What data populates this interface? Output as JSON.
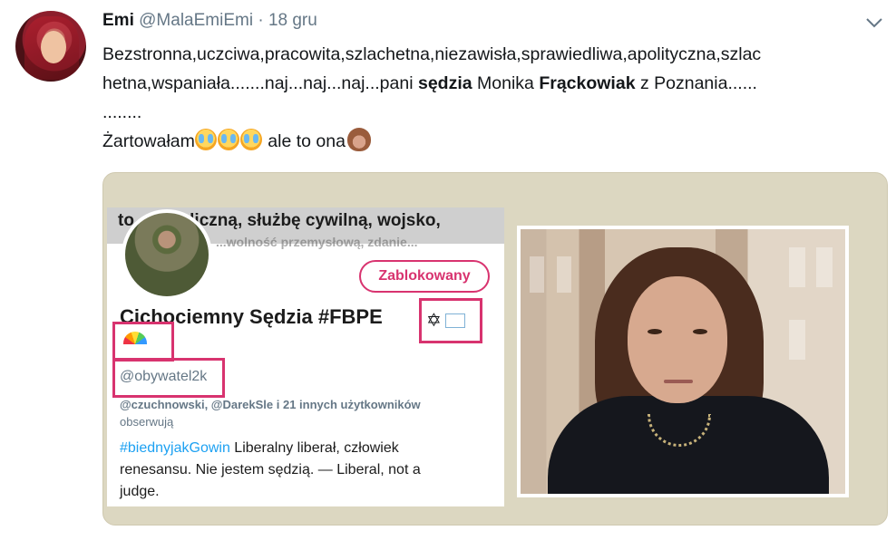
{
  "tweet": {
    "display_name": "Emi",
    "handle": "@MalaEmiEmi",
    "separator": "·",
    "date": "18 gru",
    "text": {
      "line1": "Bezstronna,uczciwa,pracowita,szlachetna,niezawisła,sprawiedliwa,apolityczna,szlac",
      "line2_part1": "hetna,wspaniała.......naj...naj...naj...pani ",
      "line2_bold1": "sędzia",
      "line2_part2": " Monika ",
      "line2_bold2": "Frąckowiak",
      "line2_part3": " z Poznania......",
      "line3": "........",
      "line4_before": "Żartowałam",
      "line4_after": " ale to ona"
    },
    "icons": {
      "menu": "chevron-down-icon",
      "laugh_emoji": "face-with-tears-of-joy-icon",
      "monkey_emoji": "see-no-evil-monkey-icon"
    }
  },
  "embedded_profile": {
    "cover_line1": "to ... publiczną, służbę cywilną, wojsko,",
    "cover_line2": "...wolność przemysłową, zdanie...",
    "block_label": "Zablokowany",
    "name": "Cichociemny Sędzia #FBPE",
    "name_icons": "✡",
    "handle": "@obywatel2k",
    "followers_line1": "@czuchnowski, @DarekSle i 21 innych użytkowników",
    "followers_line2": "obserwują",
    "bio_hashtag": "#biednyjakGowin",
    "bio_line1_rest": " Liberalny liberał, człowiek",
    "bio_line2": "renesansu. Nie jestem sędzią. — Liberal, not a",
    "bio_line3": "judge."
  },
  "colors": {
    "highlight": "#d8336f",
    "link": "#1da1f2",
    "muted": "#657786",
    "media_bg": "#dcd7c1"
  }
}
